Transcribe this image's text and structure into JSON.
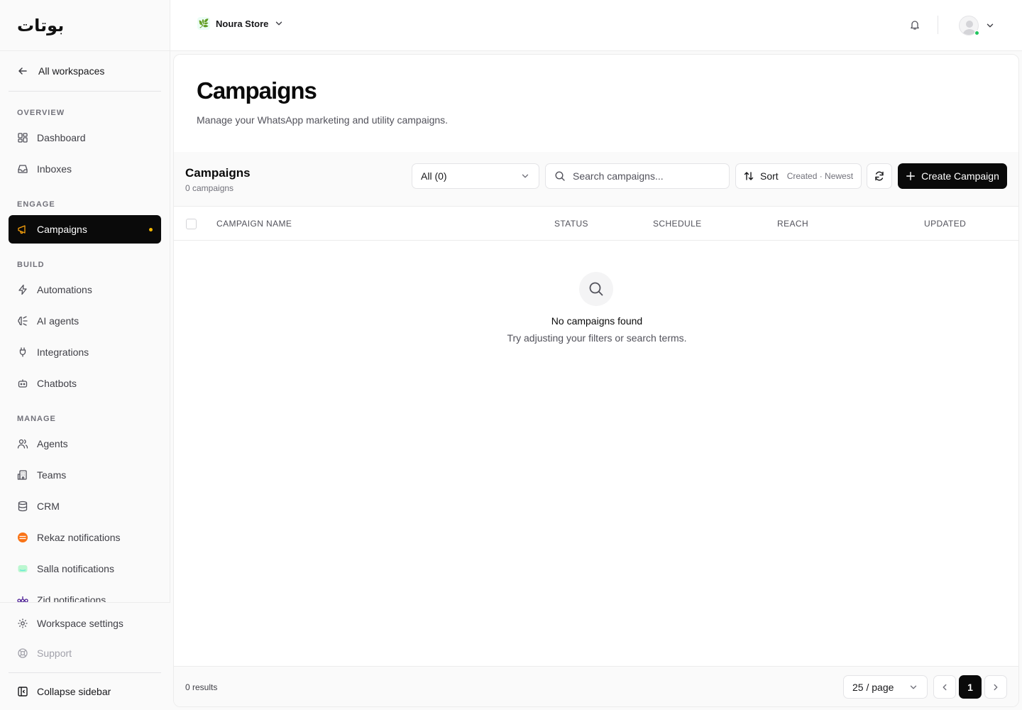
{
  "brand": {
    "logo_text": "بوتات"
  },
  "sidebar": {
    "back_label": "All workspaces",
    "sections": {
      "overview": "OVERVIEW",
      "engage": "ENGAGE",
      "build": "BUILD",
      "manage": "MANAGE"
    },
    "items": {
      "dashboard": "Dashboard",
      "inboxes": "Inboxes",
      "campaigns": "Campaigns",
      "automations": "Automations",
      "ai_agents": "AI agents",
      "integrations": "Integrations",
      "chatbots": "Chatbots",
      "agents": "Agents",
      "teams": "Teams",
      "crm": "CRM",
      "rekaz": "Rekaz notifications",
      "salla": "Salla notifications",
      "zid": "Zid notifications"
    },
    "active_item": "campaigns",
    "workspace_settings": "Workspace settings",
    "support": "Support",
    "collapse": "Collapse sidebar"
  },
  "topbar": {
    "store_name": "Noura Store",
    "store_icon": "leaf-icon",
    "notification_icon": "bell-icon"
  },
  "page": {
    "title": "Campaigns",
    "subtitle": "Manage your WhatsApp marketing and utility campaigns."
  },
  "toolbar": {
    "title": "Campaigns",
    "count_label": "0 campaigns",
    "filter_value": "All (0)",
    "search_placeholder": "Search campaigns...",
    "sort_label": "Sort",
    "sort_meta": "Created · Newest",
    "create_label": "Create Campaign"
  },
  "table": {
    "columns": [
      "CAMPAIGN NAME",
      "STATUS",
      "SCHEDULE",
      "REACH",
      "UPDATED"
    ],
    "rows": []
  },
  "empty_state": {
    "title": "No campaigns found",
    "subtitle": "Try adjusting your filters or search terms."
  },
  "footer": {
    "results_label": "0 results",
    "per_page": "25 / page",
    "current_page": "1"
  },
  "colors": {
    "accent": "#0a0a0a",
    "active_dot": "#f5b700",
    "online": "#22c55e"
  }
}
